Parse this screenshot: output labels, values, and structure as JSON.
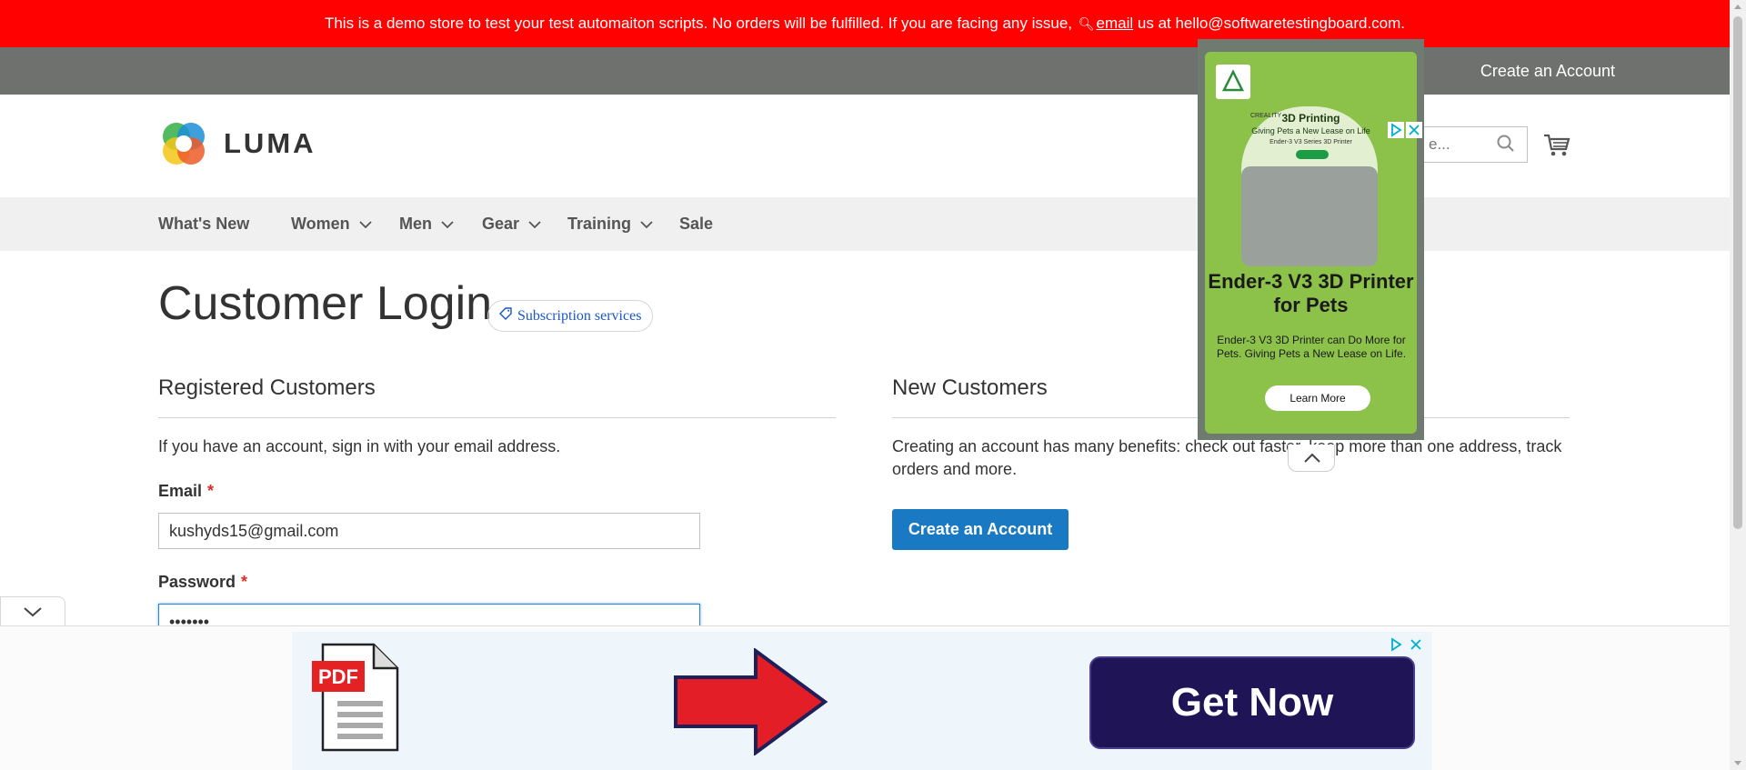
{
  "promo": {
    "text_before": "This is a demo store to test your test automaiton scripts. No orders will be fulfilled. If you are facing any issue,",
    "link_text": "email",
    "text_after": "us at hello@softwaretestingboard.com."
  },
  "panel": {
    "create_account": "Create an Account"
  },
  "header": {
    "logo_text": "LUMA",
    "search_placeholder": "e..."
  },
  "nav": {
    "items": [
      {
        "label": "What's New",
        "has_submenu": false
      },
      {
        "label": "Women",
        "has_submenu": true
      },
      {
        "label": "Men",
        "has_submenu": true
      },
      {
        "label": "Gear",
        "has_submenu": true
      },
      {
        "label": "Training",
        "has_submenu": true
      },
      {
        "label": "Sale",
        "has_submenu": false
      }
    ]
  },
  "page": {
    "title": "Customer Login",
    "subscription_pill": "Subscription services"
  },
  "registered": {
    "heading": "Registered Customers",
    "intro": "If you have an account, sign in with your email address.",
    "email_label": "Email",
    "email_value": "kushyds15@gmail.com",
    "password_label": "Password",
    "password_value": "•••••••",
    "required_mark": "*"
  },
  "new_customers": {
    "heading": "New Customers",
    "description": "Creating an account has many benefits: check out faster, keep more than one address, track orders and more.",
    "button": "Create an Account"
  },
  "side_ad": {
    "brand": "CREALITY",
    "headline": "3D Printing",
    "subhead": "Giving Pets a New Lease on Life",
    "series": "Ender-3 V3 Series 3D Printer",
    "title": "Ender-3 V3 3D Printer for Pets",
    "body": "Ender-3 V3 3D Printer can Do More for Pets. Giving Pets a New Lease on Life.",
    "cta": "Learn More"
  },
  "bottom_ad": {
    "pdf_label": "PDF",
    "cta": "Get Now"
  },
  "colors": {
    "promo_bg": "#ff0101",
    "panel_bg": "#6e716e",
    "primary": "#1979c3",
    "required": "#e02b27",
    "ad_green": "#8cc14a"
  }
}
